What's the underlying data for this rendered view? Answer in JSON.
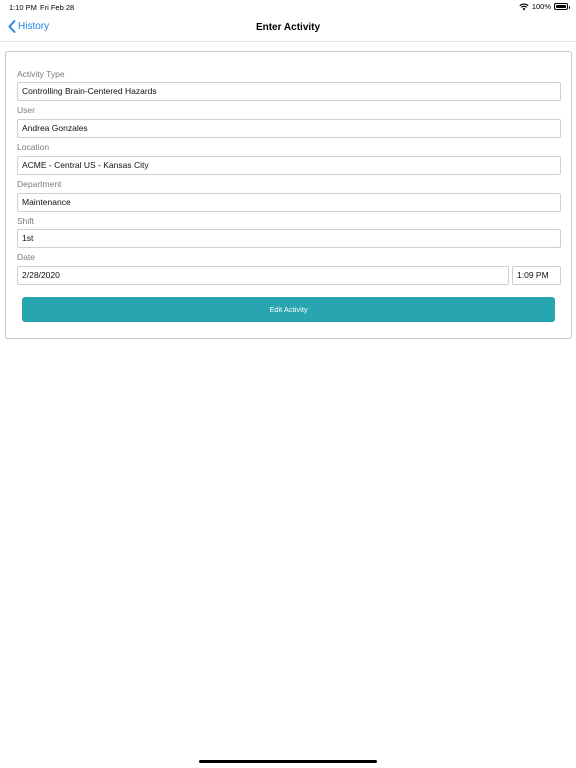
{
  "status_bar": {
    "time": "1:10 PM",
    "date": "Fri Feb 28",
    "battery": "100%",
    "icons": [
      "wifi-icon",
      "battery-icon"
    ]
  },
  "nav": {
    "back_label": "History",
    "back_icon": "chevron-left-icon",
    "title": "Enter Activity",
    "accent_color": "#1a82e8"
  },
  "form": {
    "activity_type": {
      "label": "Activity Type",
      "value": "Controlling Brain-Centered Hazards"
    },
    "user": {
      "label": "User",
      "value": "Andrea Gonzales"
    },
    "location": {
      "label": "Location",
      "value": "ACME - Central US -  Kansas City"
    },
    "department": {
      "label": "Department",
      "value": "Maintenance"
    },
    "shift": {
      "label": "Shift",
      "value": "1st"
    },
    "date": {
      "label": "Date",
      "date_value": "2/28/2020",
      "time_value": "1:09 PM"
    }
  },
  "actions": {
    "edit_label": "Edit Activity",
    "button_color": "#27a5b1"
  }
}
